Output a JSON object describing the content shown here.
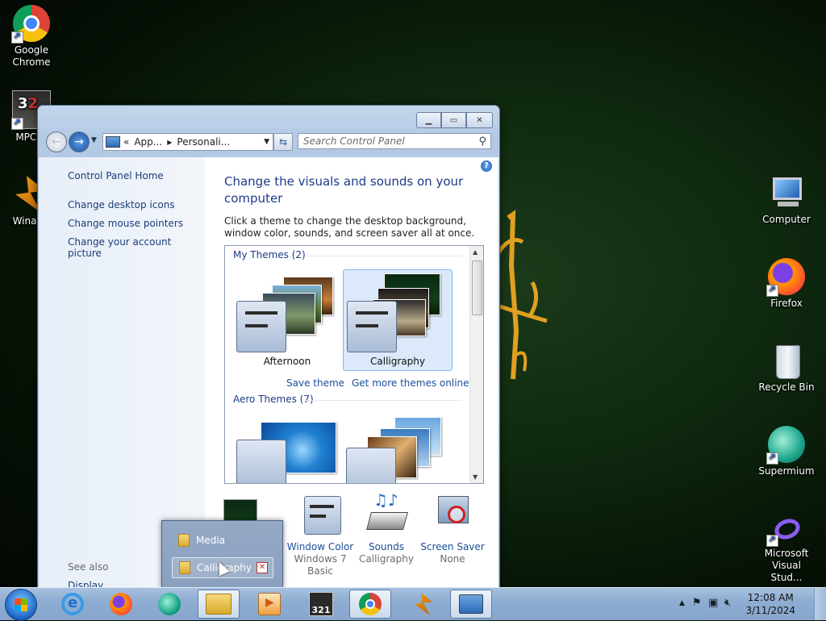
{
  "desktop": {
    "icons_left": [
      {
        "label": "Google\nChrome",
        "name": "google-chrome-icon"
      },
      {
        "label": "MPC-H",
        "name": "mpc-hc-icon"
      },
      {
        "label": "Winar",
        "name": "winamp-icon"
      }
    ],
    "icons_right": [
      {
        "label": "Computer",
        "name": "computer-icon"
      },
      {
        "label": "Firefox",
        "name": "firefox-icon"
      },
      {
        "label": "Recycle Bin",
        "name": "recycle-bin-icon"
      },
      {
        "label": "Supermium",
        "name": "supermium-icon"
      },
      {
        "label": "Microsoft\nVisual Stud...",
        "name": "visual-studio-icon"
      }
    ]
  },
  "window": {
    "address": {
      "sep": "«",
      "part1": "App...",
      "part2": "Personali..."
    },
    "search": {
      "placeholder": "Search Control Panel"
    },
    "left": {
      "home": "Control Panel Home",
      "links": [
        "Change desktop icons",
        "Change mouse pointers",
        "Change your account picture"
      ],
      "see_also": "See also",
      "display": "Display"
    },
    "main": {
      "heading": "Change the visuals and sounds on your computer",
      "description": "Click a theme to change the desktop background, window color, sounds, and screen saver all at once.",
      "my_themes": "My Themes (2)",
      "themes": [
        {
          "name": "Afternoon",
          "selected": false
        },
        {
          "name": "Calligraphy",
          "selected": true
        }
      ],
      "save_theme": "Save theme",
      "get_more": "Get more themes online",
      "aero_themes": "Aero Themes (7)"
    },
    "bottom": [
      {
        "label": "Window Color",
        "sub": "Windows 7 Basic"
      },
      {
        "label": "Sounds",
        "sub": "Calligraphy"
      },
      {
        "label": "Screen Saver",
        "sub": "None"
      }
    ]
  },
  "jumplist": {
    "items": [
      "Media",
      "Calligraphy"
    ]
  },
  "taskbar": {
    "time": "12:08 AM",
    "date": "3/11/2024"
  }
}
